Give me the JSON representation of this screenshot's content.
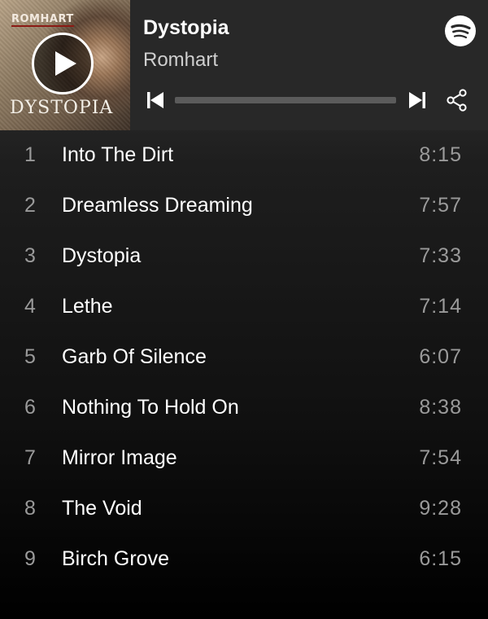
{
  "album": {
    "title": "Dystopia",
    "artist": "Romhart",
    "cover_brand_text": "ROMHART",
    "cover_title_text": "DYSTOPIA"
  },
  "controls": {
    "play_icon": "play-icon",
    "previous_icon": "skip-previous-icon",
    "next_icon": "skip-next-icon",
    "share_icon": "share-icon",
    "logo_icon": "spotify-logo-icon",
    "progress_fraction": 0.0
  },
  "colors": {
    "header_bg": "#282828",
    "text_primary": "#ffffff",
    "text_secondary": "#9a9a9a",
    "progress_track": "#5b5b5b",
    "progress_fill": "#b3b3b3"
  },
  "tracks": [
    {
      "number": "1",
      "title": "Into The Dirt",
      "duration": "8:15"
    },
    {
      "number": "2",
      "title": "Dreamless Dreaming",
      "duration": "7:57"
    },
    {
      "number": "3",
      "title": "Dystopia",
      "duration": "7:33"
    },
    {
      "number": "4",
      "title": "Lethe",
      "duration": "7:14"
    },
    {
      "number": "5",
      "title": "Garb Of Silence",
      "duration": "6:07"
    },
    {
      "number": "6",
      "title": "Nothing To Hold On",
      "duration": "8:38"
    },
    {
      "number": "7",
      "title": "Mirror Image",
      "duration": "7:54"
    },
    {
      "number": "8",
      "title": "The Void",
      "duration": "9:28"
    },
    {
      "number": "9",
      "title": "Birch Grove",
      "duration": "6:15"
    }
  ]
}
